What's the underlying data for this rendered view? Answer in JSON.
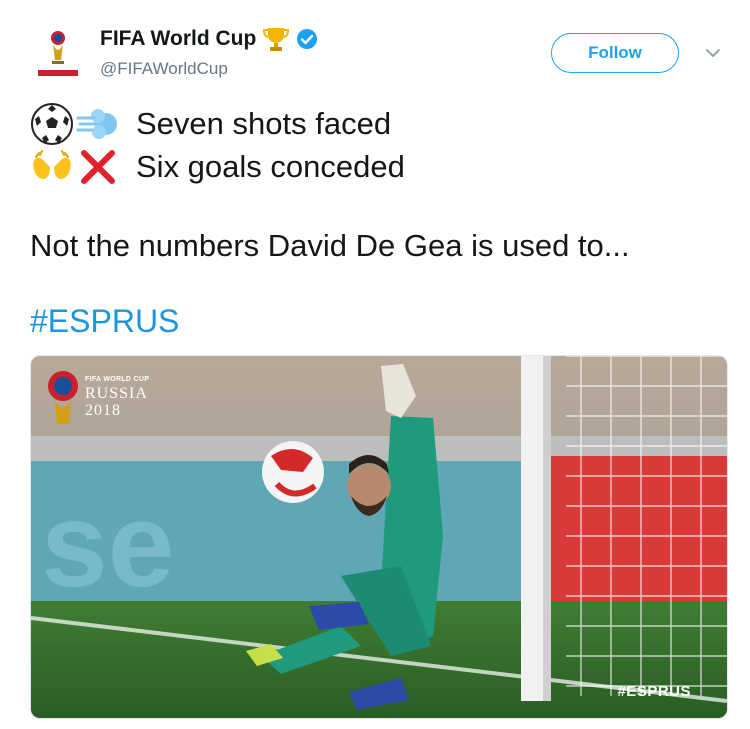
{
  "account": {
    "display_name": "FIFA World Cup",
    "handle": "@FIFAWorldCup",
    "verified": true,
    "name_emoji": "trophy-icon"
  },
  "actions": {
    "follow_label": "Follow",
    "menu_icon": "chevron-down-icon"
  },
  "tweet": {
    "line1": "Seven shots faced",
    "line1_emojis": [
      "soccer-ball-icon",
      "dash-icon"
    ],
    "line2": "Six goals conceded",
    "line2_emojis": [
      "open-hands-icon",
      "cross-mark-icon"
    ],
    "line3": "Not the numbers David De Gea is used to...",
    "hashtag": "#ESPRUS"
  },
  "media": {
    "logo_small": "FIFA WORLD CUP",
    "logo_country": "RUSSIA",
    "logo_year": "2018",
    "photo_hashtag": "#ESPRUS"
  },
  "colors": {
    "link": "#1b95e0",
    "follow": "#1da1f2",
    "secondary": "#657786",
    "pitch": "#2f6a2a",
    "kit": "#1f9a7f"
  }
}
